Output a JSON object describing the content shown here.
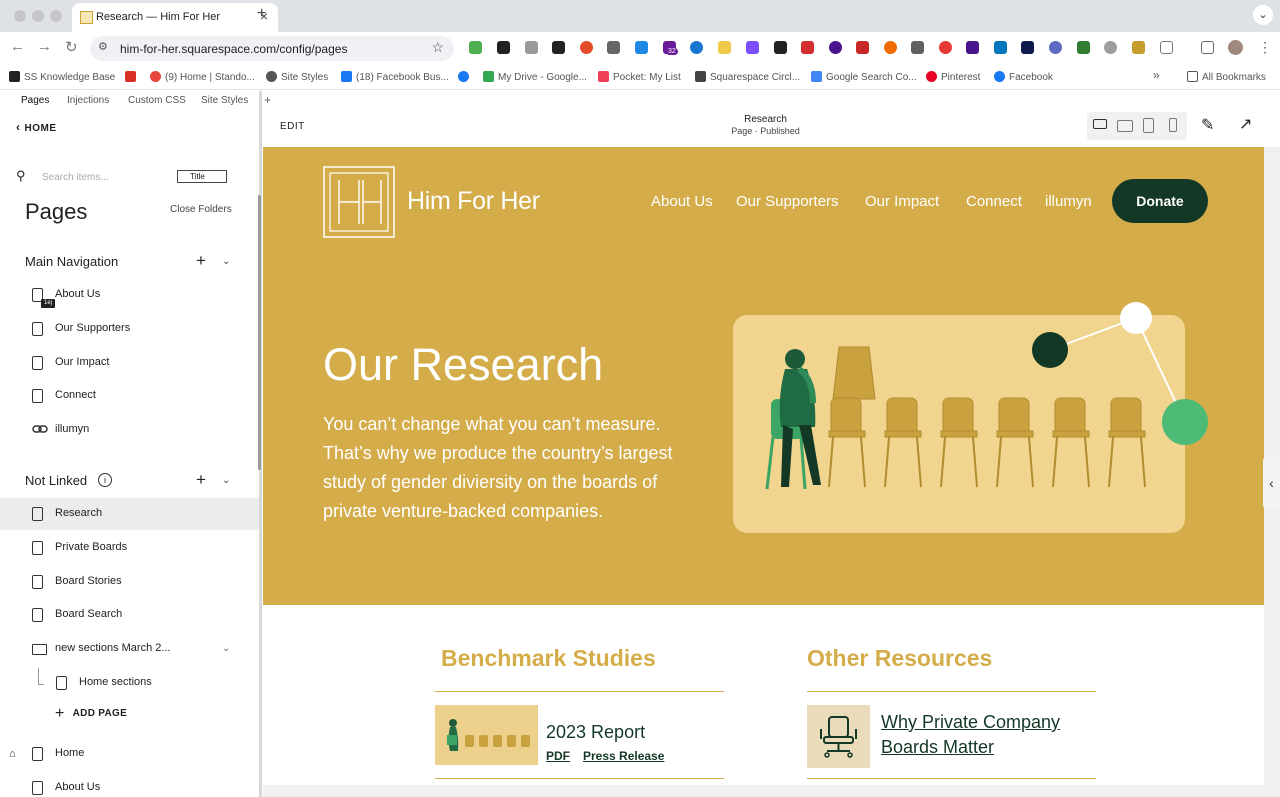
{
  "browser": {
    "tab_title": "Research — Him For Her",
    "url": "him-for-her.squarespace.com/config/pages",
    "new_tab_glyph": "+",
    "extension_badge": "32",
    "bookmarks": [
      {
        "label": "SS Knowledge Base",
        "color": "#222222"
      },
      {
        "label": "",
        "color": "#d93025",
        "icon": "gmail-icon"
      },
      {
        "label": "(9) Home | Stando...",
        "color": "#e8453c"
      },
      {
        "label": "Site Styles",
        "color": "#555555"
      },
      {
        "label": "(18) Facebook Bus...",
        "color": "#1877f2"
      },
      {
        "label": "",
        "color": "#1877f2",
        "icon": "facebook-icon"
      },
      {
        "label": "My Drive - Google...",
        "color": "#34a853"
      },
      {
        "label": "Pocket: My List",
        "color": "#ef4056"
      },
      {
        "label": "Squarespace Circl...",
        "color": "#444444"
      },
      {
        "label": "Google Search Co...",
        "color": "#4285f4"
      },
      {
        "label": "Pinterest",
        "color": "#e60023"
      },
      {
        "label": "Facebook",
        "color": "#1877f2"
      }
    ],
    "all_bookmarks": "All Bookmarks",
    "more_glyph": "»"
  },
  "panel": {
    "tabs": [
      "Pages",
      "Injections",
      "Custom CSS",
      "Site Styles"
    ],
    "back_label": "HOME",
    "search_placeholder": "Search items...",
    "search_filter": "Title",
    "heading": "Pages",
    "close_folders": "Close Folders",
    "main_nav_heading": "Main Navigation",
    "not_linked_heading": "Not Linked",
    "info_glyph": "i",
    "main_nav_items": [
      {
        "label": "About Us",
        "kind": "page"
      },
      {
        "label": "Our Supporters",
        "kind": "page"
      },
      {
        "label": "Our Impact",
        "kind": "page"
      },
      {
        "label": "Connect",
        "kind": "page"
      },
      {
        "label": "illumyn",
        "kind": "link"
      }
    ],
    "not_linked_items": [
      {
        "label": "Research",
        "kind": "page",
        "selected": true
      },
      {
        "label": "Private Boards",
        "kind": "page"
      },
      {
        "label": "Board Stories",
        "kind": "page"
      },
      {
        "label": "Board Search",
        "kind": "page"
      },
      {
        "label": "new sections March 2...",
        "kind": "folder"
      }
    ],
    "child_items": [
      {
        "label": "Home sections",
        "kind": "page"
      }
    ],
    "add_page": "ADD PAGE",
    "bottom_items": [
      {
        "label": "Home",
        "kind": "page"
      },
      {
        "label": "About Us",
        "kind": "page"
      }
    ],
    "badge_text": "1ej"
  },
  "editor": {
    "edit_label": "EDIT",
    "page_title": "Research",
    "page_status": "Page · Published"
  },
  "site": {
    "brand": "Him For Her",
    "nav": [
      "About Us",
      "Our Supporters",
      "Our Impact",
      "Connect",
      "illumyn"
    ],
    "donate": "Donate",
    "hero_title": "Our Research",
    "hero_text": "You can’t change what you can’t measure. That’s why we produce the country’s largest study of gender diviersity on the boards of private venture-backed companies.",
    "col1_heading": "Benchmark Studies",
    "col2_heading": "Other Resources",
    "report_title": "2023 Report",
    "report_links": [
      "PDF",
      "Press Release"
    ],
    "resource_title": "Why Private Company Boards Matter"
  },
  "colors": {
    "gold": "#d4ad4a",
    "dark_green": "#143826",
    "mint": "#4dbb75",
    "card": "#f1d48e"
  }
}
